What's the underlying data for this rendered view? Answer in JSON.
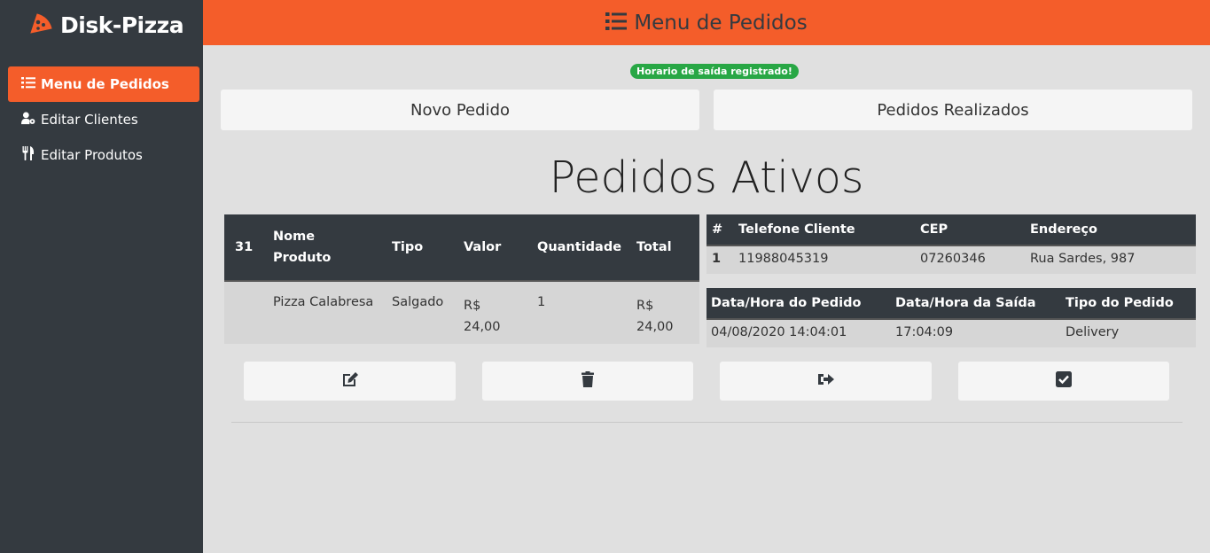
{
  "sidebar": {
    "brand": "Disk-Pizza",
    "brand_icon": "pizza-slice-icon",
    "items": [
      {
        "label": "Menu de Pedidos",
        "icon": "list-icon",
        "active": true
      },
      {
        "label": "Editar Clientes",
        "icon": "user-cog-icon",
        "active": false
      },
      {
        "label": "Editar Produtos",
        "icon": "utensils-icon",
        "active": false
      }
    ]
  },
  "header": {
    "title": "Menu de Pedidos",
    "icon": "list-icon"
  },
  "alert": {
    "text": "Horario de saída registrado!"
  },
  "top_buttons": {
    "new_order": "Novo Pedido",
    "orders_done": "Pedidos Realizados"
  },
  "main": {
    "title": "Pedidos Ativos"
  },
  "order_items": {
    "order_id": "31",
    "headers": [
      "Nome Produto",
      "Tipo",
      "Valor",
      "Quantidade",
      "Total"
    ],
    "header_name_line1": "Nome",
    "header_name_line2": "Produto",
    "rows": [
      {
        "produto": "Pizza Calabresa",
        "tipo": "Salgado",
        "valor_cur": "R$",
        "valor_num": "24,00",
        "quantidade": "1",
        "total_cur": "R$",
        "total_num": "24,00"
      }
    ]
  },
  "client_table": {
    "headers": [
      "#",
      "Telefone Cliente",
      "CEP",
      "Endereço"
    ],
    "rows": [
      {
        "id": "1",
        "telefone": "11988045319",
        "cep": "07260346",
        "endereco": "Rua Sardes, 987"
      }
    ]
  },
  "time_table": {
    "headers": [
      "Data/Hora do Pedido",
      "Data/Hora da Saída",
      "Tipo do Pedido"
    ],
    "rows": [
      {
        "pedido": "04/08/2020 14:04:01",
        "saida": "17:04:09",
        "tipo": "Delivery"
      }
    ]
  },
  "actions": [
    {
      "icon": "edit-icon"
    },
    {
      "icon": "trash-icon"
    },
    {
      "icon": "sign-out-icon"
    },
    {
      "icon": "check-square-icon"
    }
  ],
  "colors": {
    "accent": "#f45d2a",
    "sidebar": "#343a40",
    "success": "#28a745",
    "background": "#e0e0e0"
  }
}
